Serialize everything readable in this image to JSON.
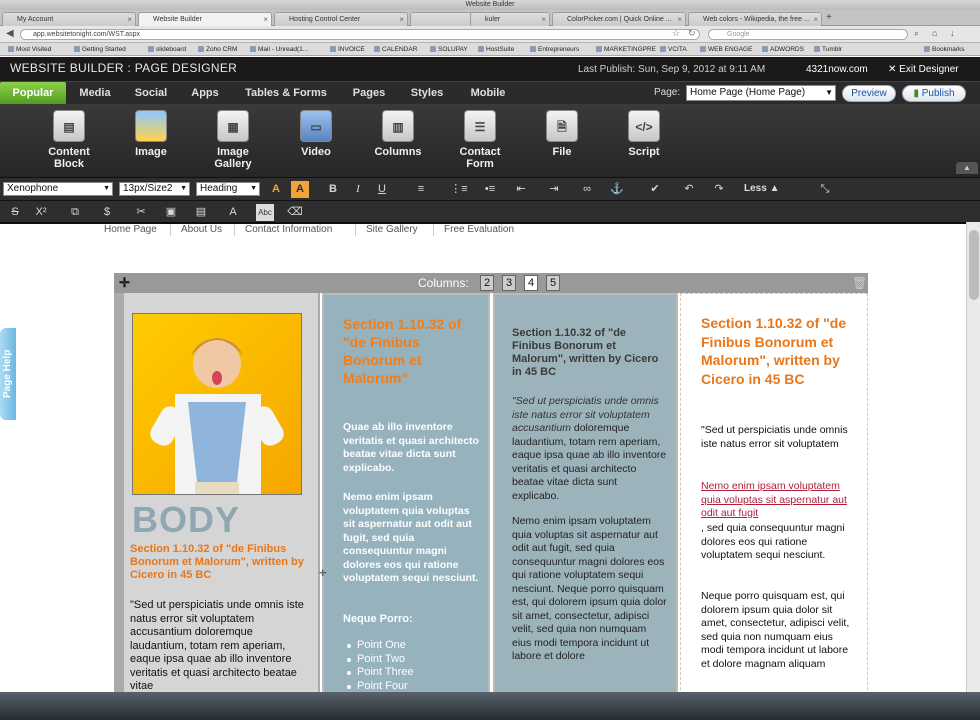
{
  "browser": {
    "window_title": "Website Builder",
    "tabs": [
      {
        "label": "My Account"
      },
      {
        "label": "Website Builder",
        "active": true
      },
      {
        "label": "Hosting Control Center"
      },
      {
        "label": ""
      },
      {
        "label": "kuler"
      },
      {
        "label": "ColorPicker.com | Quick Online ..."
      },
      {
        "label": "Web colors - Wikipedia, the free ..."
      }
    ],
    "url": "app.websitetonight.com/WST.aspx",
    "search_placeholder": "Google",
    "bookmarks": [
      "Most Visited",
      "Getting Started",
      "slideboard",
      "Zoho CRM",
      "Mail - Unread(1...",
      "INVOICE",
      "CALENDAR",
      "SOLUPAY",
      "HostSuite",
      "Entrepreneurs",
      "MARKETINGPRE",
      "VCITA",
      "WEB ENGAGE",
      "ADWORDS",
      "Tumblr",
      "Bookmarks"
    ]
  },
  "app": {
    "title": "WEBSITE BUILDER : PAGE DESIGNER",
    "last_publish": "Last Publish: Sun, Sep 9, 2012 at 9:11 AM",
    "brand": "4321now.com",
    "exit": "Exit Designer"
  },
  "nav": {
    "items": [
      "Popular",
      "Media",
      "Social",
      "Apps",
      "Tables & Forms",
      "Pages",
      "Styles",
      "Mobile"
    ],
    "page_label": "Page:",
    "page_value": "Home Page (Home Page)",
    "preview": "Preview",
    "publish": "Publish"
  },
  "ribbon": {
    "items": [
      {
        "label": "Content Block",
        "icon": "content-block-icon"
      },
      {
        "label": "Image",
        "icon": "image-icon"
      },
      {
        "label": "Image Gallery",
        "icon": "image-gallery-icon"
      },
      {
        "label": "Video",
        "icon": "video-icon"
      },
      {
        "label": "Columns",
        "icon": "columns-icon"
      },
      {
        "label": "Contact Form",
        "icon": "contact-form-icon"
      },
      {
        "label": "File",
        "icon": "file-icon"
      },
      {
        "label": "Script",
        "icon": "script-icon",
        "glyph": "</>"
      }
    ]
  },
  "format": {
    "font": "Xenophone",
    "size": "13px/Size2",
    "style": "Heading",
    "less": "Less"
  },
  "sitenav": [
    "Home Page",
    "About Us",
    "Contact Information",
    "Site Gallery",
    "Free Evaluation"
  ],
  "columns": {
    "label": "Columns:",
    "options": [
      "2",
      "3",
      "4",
      "5"
    ],
    "selected": "4"
  },
  "col1": {
    "word": "BODY",
    "heading": "Section 1.10.32 of \"de Finibus Bonorum et Malorum\", written by Cicero in 45 BC",
    "text": "\"Sed ut perspiciatis unde omnis iste natus error sit voluptatem accusantium doloremque laudantium, totam rem aperiam, eaque ipsa quae ab illo inventore veritatis et quasi architecto beatae vitae"
  },
  "col2": {
    "heading": "Section 1.10.32 of \"de Finibus Bonorum et Malorum\"",
    "p1": "Quae ab illo inventore veritatis et quasi architecto beatae vitae dicta sunt explicabo.",
    "p2": "Nemo enim ipsam voluptatem quia voluptas sit aspernatur aut odit aut fugit, sed quia consequuntur magni dolores eos qui ratione voluptatem sequi nesciunt.",
    "subheading": "Neque Porro:",
    "list": [
      "Point One",
      "Point Two",
      "Point Three",
      "Point Four"
    ]
  },
  "col3": {
    "heading": "Section 1.10.32 of \"de Finibus Bonorum et Malorum\", written by Cicero in 45 BC",
    "p1_italic": "\"Sed ut perspiciatis unde omnis iste natus error sit voluptatem accusantium",
    "p1_rest": " doloremque laudantium, totam rem aperiam, eaque ipsa quae ab illo inventore veritatis et quasi architecto beatae vitae dicta sunt explicabo.",
    "p2": "Nemo enim ipsam voluptatem quia voluptas sit aspernatur aut odit aut fugit, sed quia consequuntur magni dolores eos qui ratione voluptatem sequi nesciunt. Neque porro quisquam est, qui dolorem ipsum quia dolor sit amet, consectetur, adipisci velit, sed quia non numquam eius modi tempora incidunt ut labore et dolore"
  },
  "col4": {
    "heading": "Section 1.10.32 of \"de Finibus Bonorum et Malorum\", written by Cicero in 45 BC",
    "p1": "\"Sed ut perspiciatis unde omnis iste natus error sit voluptatem",
    "link": "Nemo enim ipsam voluptatem quia voluptas sit aspernatur aut odit aut fugit",
    "p2": ", sed quia consequuntur magni dolores eos qui ratione voluptatem sequi nesciunt.",
    "p3": "Neque porro quisquam est, qui dolorem ipsum quia dolor sit amet, consectetur, adipisci velit, sed quia non numquam eius modi tempora incidunt ut labore et dolore magnam aliquam"
  },
  "pagehelp": "Page Help",
  "colors": {
    "accent_green": "#6cbf2f",
    "heading_orange": "#e8761a",
    "link_red": "#b0203a"
  }
}
